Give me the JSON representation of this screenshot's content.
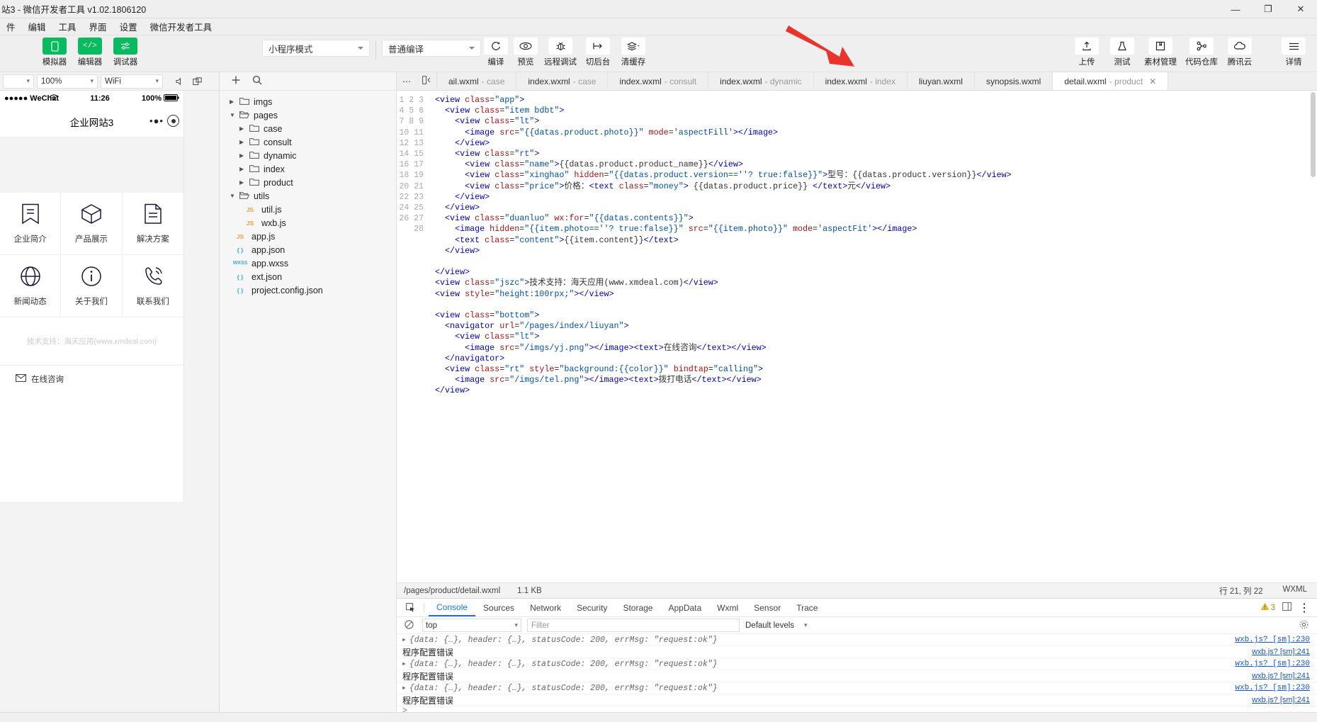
{
  "window": {
    "title": "站3 - 微信开发者工具 v1.02.1806120",
    "controls": {
      "minimize": "—",
      "maximize": "❐",
      "close": "✕"
    }
  },
  "menubar": {
    "items": [
      "件",
      "编辑",
      "工具",
      "界面",
      "设置",
      "微信开发者工具"
    ]
  },
  "toolbar": {
    "left_items": [
      {
        "label": "模拟器",
        "icon": "phone-icon"
      },
      {
        "label": "编辑器",
        "icon": "code-icon"
      },
      {
        "label": "调试器",
        "icon": "sliders-icon"
      }
    ],
    "mode_select": "小程序模式",
    "compile_select": "普通编译",
    "compile_label": "编译",
    "preview_label": "预览",
    "right_items": [
      {
        "label": "远程调试",
        "icon": "bug-icon"
      },
      {
        "label": "切后台",
        "icon": "background-icon"
      },
      {
        "label": "清缓存",
        "icon": "layers-icon"
      }
    ],
    "far_right_items": [
      {
        "label": "上传",
        "icon": "upload-icon"
      },
      {
        "label": "测试",
        "icon": "flask-icon"
      },
      {
        "label": "素材管理",
        "icon": "archive-icon"
      },
      {
        "label": "代码仓库",
        "icon": "git-icon"
      },
      {
        "label": "腾讯云",
        "icon": "cloud-icon"
      },
      {
        "label": "详情",
        "icon": "menu-icon"
      }
    ]
  },
  "simulator": {
    "device_select": "",
    "zoom_select": "100%",
    "network_select": "WiFi",
    "volume_icon": "volume-icon",
    "rotate_icon": "rotate-screen-icon",
    "status": {
      "carrier": "●●●●● WeChat",
      "wifi": "wifi-icon",
      "time": "11:26",
      "battery_pct": "100%"
    },
    "nav_title": "企业网站3",
    "menu_dots": "•●•",
    "grid": [
      {
        "label": "企业简介",
        "icon": "bookmark-icon"
      },
      {
        "label": "产品展示",
        "icon": "cube-icon"
      },
      {
        "label": "解决方案",
        "icon": "document-icon"
      },
      {
        "label": "新闻动态",
        "icon": "globe-icon"
      },
      {
        "label": "关于我们",
        "icon": "info-icon"
      },
      {
        "label": "联系我们",
        "icon": "phone-call-icon"
      }
    ],
    "footer": "技术支持：海天应用(www.xmdeal.com)",
    "bottom_action": "在线咨询",
    "bottom_icon": "mail-icon"
  },
  "filetree": {
    "add_icon": "plus-icon",
    "search_icon": "search-icon",
    "nodes": [
      {
        "label": "imgs",
        "type": "folder",
        "depth": 0,
        "open": false
      },
      {
        "label": "pages",
        "type": "folder",
        "depth": 0,
        "open": true
      },
      {
        "label": "case",
        "type": "folder",
        "depth": 1,
        "open": false
      },
      {
        "label": "consult",
        "type": "folder",
        "depth": 1,
        "open": false
      },
      {
        "label": "dynamic",
        "type": "folder",
        "depth": 1,
        "open": false
      },
      {
        "label": "index",
        "type": "folder",
        "depth": 1,
        "open": false
      },
      {
        "label": "product",
        "type": "folder",
        "depth": 1,
        "open": false
      },
      {
        "label": "utils",
        "type": "folder",
        "depth": 0,
        "open": true
      },
      {
        "label": "util.js",
        "type": "js",
        "depth": 1,
        "badge": "JS"
      },
      {
        "label": "wxb.js",
        "type": "js",
        "depth": 1,
        "badge": "JS"
      },
      {
        "label": "app.js",
        "type": "js",
        "depth": 0,
        "badge": "JS"
      },
      {
        "label": "app.json",
        "type": "json",
        "depth": 0,
        "badge": "{ }"
      },
      {
        "label": "app.wxss",
        "type": "wxss",
        "depth": 0,
        "badge": "WXSS"
      },
      {
        "label": "ext.json",
        "type": "json",
        "depth": 0,
        "badge": "{ }"
      },
      {
        "label": "project.config.json",
        "type": "json",
        "depth": 0,
        "badge": "{ }"
      }
    ]
  },
  "editor": {
    "tabs": [
      {
        "name": "ail.wxml",
        "sub": "case",
        "active": false
      },
      {
        "name": "index.wxml",
        "sub": "case",
        "active": false
      },
      {
        "name": "index.wxml",
        "sub": "consult",
        "active": false
      },
      {
        "name": "index.wxml",
        "sub": "dynamic",
        "active": false
      },
      {
        "name": "index.wxml",
        "sub": "index",
        "active": false
      },
      {
        "name": "liuyan.wxml",
        "sub": "",
        "active": false
      },
      {
        "name": "synopsis.wxml",
        "sub": "",
        "active": false
      },
      {
        "name": "detail.wxml",
        "sub": "product",
        "active": true
      }
    ],
    "overflow_icon": "more-icon",
    "split_icon": "split-editor-icon",
    "close_icon": "close-icon",
    "line_count": 28,
    "lines": [
      "<view class=\"app\">",
      "  <view class=\"item bdbt\">",
      "    <view class=\"lt\">",
      "      <image src=\"{{datas.product.photo}}\" mode='aspectFill'></image>",
      "    </view>",
      "    <view class=\"rt\">",
      "      <view class=\"name\">{{datas.product.product_name}}</view>",
      "      <view class=\"xinghao\" hidden=\"{{datas.product.version==''? true:false}}\">型号：{{datas.product.version}}</view>",
      "      <view class=\"price\">价格：<text class=\"money\"> {{datas.product.price}} </text>元</view>",
      "    </view>",
      "  </view>",
      "  <view class=\"duanluo\" wx:for=\"{{datas.contents}}\">",
      "    <image hidden=\"{{item.photo==''? true:false}}\" src=\"{{item.photo}}\" mode='aspectFit'></image>",
      "    <text class=\"content\">{{item.content}}</text>",
      "  </view>",
      "",
      "</view>",
      "<view class=\"jszc\">技术支持：海天应用(www.xmdeal.com)</view>",
      "<view style=\"height:100rpx;\"></view>",
      "",
      "<view class=\"bottom\">",
      "  <navigator url=\"/pages/index/liuyan\">",
      "    <view class=\"lt\">",
      "      <image src=\"/imgs/yj.png\"></image><text>在线咨询</text></view>",
      "  </navigator>",
      "  <view class=\"rt\" style=\"background:{{color}}\" bindtap=\"calling\">",
      "    <image src=\"/imgs/tel.png\"></image><text>拨打电话</text></view>",
      "</view>"
    ],
    "status_path": "/pages/product/detail.wxml",
    "status_size": "1.1 KB",
    "status_cursor": "行 21, 列 22",
    "status_lang": "WXML"
  },
  "devtools": {
    "cursor_icon": "inspect-icon",
    "tabs": [
      "Console",
      "Sources",
      "Network",
      "Security",
      "Storage",
      "AppData",
      "Wxml",
      "Sensor",
      "Trace"
    ],
    "active_tab": "Console",
    "warning_count": "3",
    "warning_icon": "warning-icon",
    "dock_icon": "dock-icon",
    "more_icon": "more-vertical-icon",
    "clear_icon": "clear-console-icon",
    "context": "top",
    "filter_placeholder": "Filter",
    "levels": "Default levels",
    "settings_icon": "gear-icon",
    "rows": [
      {
        "kind": "object",
        "text": "{data: {…}, header: {…}, statusCode: 200, errMsg: \"request:ok\"}",
        "source": "wxb.js? [sm]:230"
      },
      {
        "kind": "error",
        "text": "程序配置错误",
        "source": "wxb.js? [sm]:241"
      },
      {
        "kind": "object",
        "text": "{data: {…}, header: {…}, statusCode: 200, errMsg: \"request:ok\"}",
        "source": "wxb.js? [sm]:230"
      },
      {
        "kind": "error",
        "text": "程序配置错误",
        "source": "wxb.js? [sm]:241"
      },
      {
        "kind": "object",
        "text": "{data: {…}, header: {…}, statusCode: 200, errMsg: \"request:ok\"}",
        "source": "wxb.js? [sm]:230"
      },
      {
        "kind": "error",
        "text": "程序配置错误",
        "source": "wxb.js? [sm]:241"
      }
    ],
    "prompt": ">"
  },
  "colors": {
    "accent_green": "#09bb5f",
    "link_blue": "#1155cc",
    "active_blue": "#1a73e8",
    "arrow_red": "#e8342a"
  }
}
